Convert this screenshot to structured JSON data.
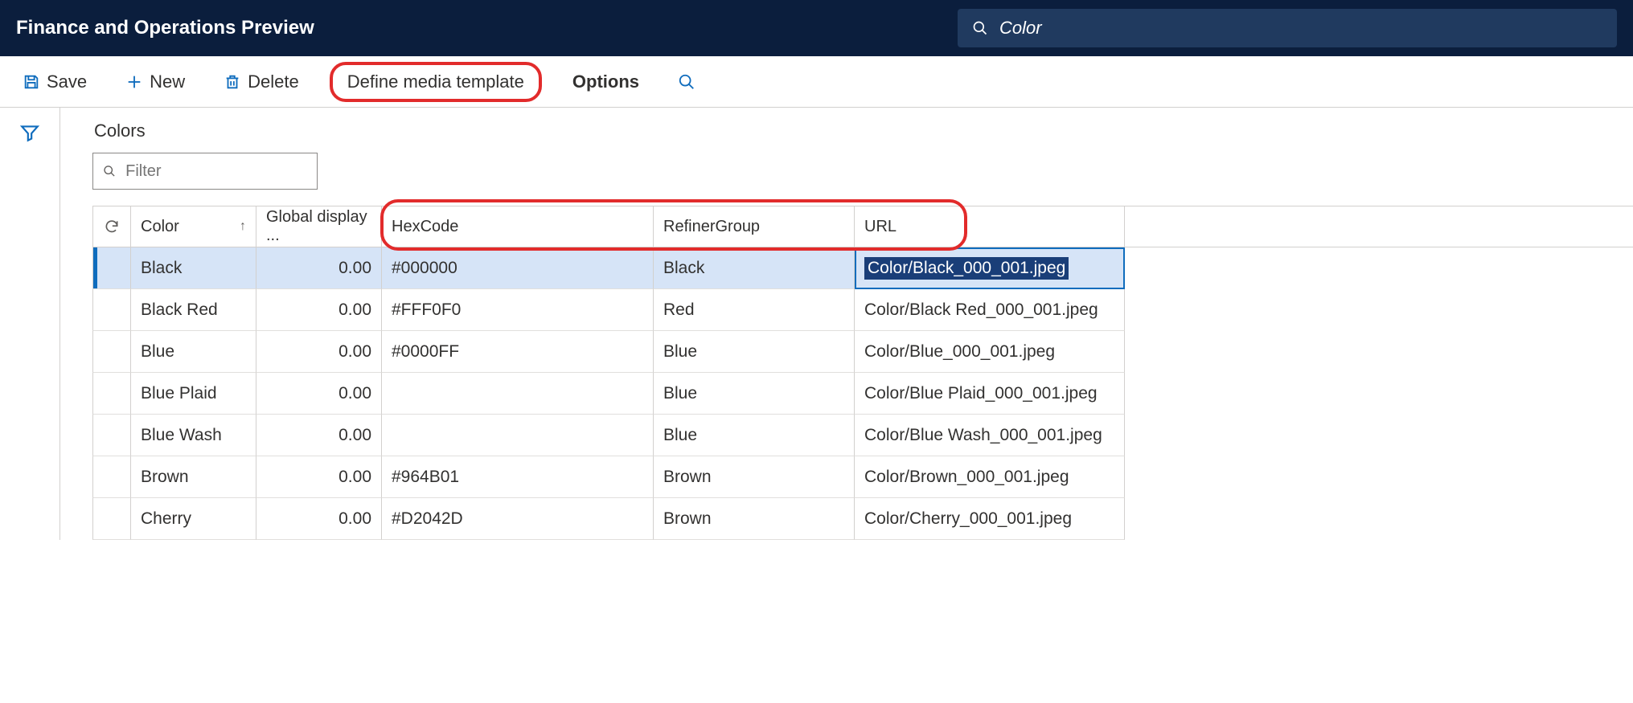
{
  "topbar": {
    "title": "Finance and Operations Preview",
    "search_value": "Color"
  },
  "actions": {
    "save": "Save",
    "new": "New",
    "delete": "Delete",
    "define_media_template": "Define media template",
    "options": "Options"
  },
  "page": {
    "title": "Colors",
    "filter_placeholder": "Filter"
  },
  "grid": {
    "headers": {
      "color": "Color",
      "global_display": "Global display ...",
      "hexcode": "HexCode",
      "refiner_group": "RefinerGroup",
      "url": "URL"
    },
    "rows": [
      {
        "color": "Black",
        "global_display": "0.00",
        "hexcode": "#000000",
        "refiner_group": "Black",
        "url": "Color/Black_000_001.jpeg",
        "selected": true
      },
      {
        "color": "Black Red",
        "global_display": "0.00",
        "hexcode": "#FFF0F0",
        "refiner_group": "Red",
        "url": "Color/Black Red_000_001.jpeg",
        "selected": false
      },
      {
        "color": "Blue",
        "global_display": "0.00",
        "hexcode": "#0000FF",
        "refiner_group": "Blue",
        "url": "Color/Blue_000_001.jpeg",
        "selected": false
      },
      {
        "color": "Blue Plaid",
        "global_display": "0.00",
        "hexcode": "",
        "refiner_group": "Blue",
        "url": "Color/Blue Plaid_000_001.jpeg",
        "selected": false
      },
      {
        "color": "Blue Wash",
        "global_display": "0.00",
        "hexcode": "",
        "refiner_group": "Blue",
        "url": "Color/Blue Wash_000_001.jpeg",
        "selected": false
      },
      {
        "color": "Brown",
        "global_display": "0.00",
        "hexcode": "#964B01",
        "refiner_group": "Brown",
        "url": "Color/Brown_000_001.jpeg",
        "selected": false
      },
      {
        "color": "Cherry",
        "global_display": "0.00",
        "hexcode": "#D2042D",
        "refiner_group": "Brown",
        "url": "Color/Cherry_000_001.jpeg",
        "selected": false
      }
    ]
  }
}
